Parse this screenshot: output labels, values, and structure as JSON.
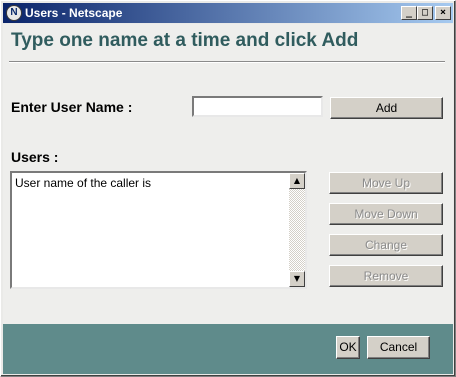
{
  "window": {
    "title": "Users - Netscape",
    "icon": "netscape-n-icon",
    "icon_letter": "N"
  },
  "titlebar_buttons": {
    "minimize": "_",
    "maximize": "□",
    "close": "×"
  },
  "heading": "Type one name at a time and click Add",
  "form": {
    "user_name_label": "Enter User Name :",
    "user_name_value": "",
    "add_label": "Add",
    "users_label": "Users :",
    "users": [
      "User name of the caller is"
    ]
  },
  "list_buttons": {
    "move_up": "Move Up",
    "move_down": "Move Down",
    "change": "Change",
    "remove": "Remove"
  },
  "scrollbar": {
    "up": "▲",
    "down": "▼"
  },
  "footer": {
    "ok": "OK",
    "cancel": "Cancel"
  },
  "colors": {
    "heading": "#305c5e",
    "footer": "#5f8b8b",
    "titlebar": "#0a246a"
  }
}
